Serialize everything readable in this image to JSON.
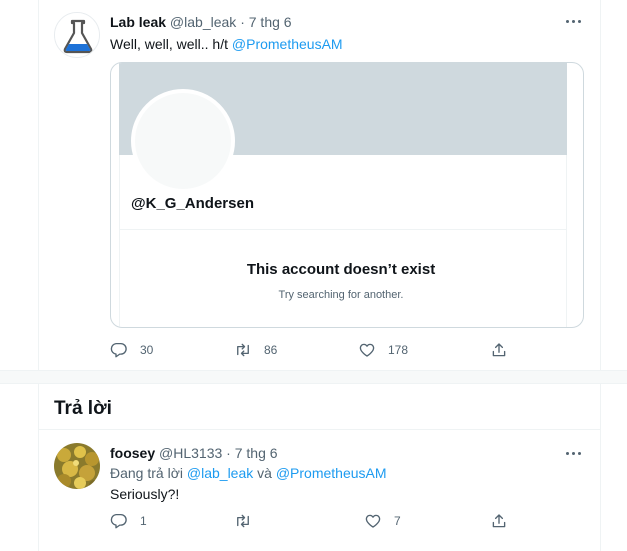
{
  "tweet": {
    "author_name": "Lab leak",
    "handle": "@lab_leak",
    "dot": "·",
    "date": "7 thg 6",
    "text": "Well, well, well.. h/t",
    "mention": "@PrometheusAM",
    "card": {
      "handle": "@K_G_Andersen",
      "title": "This account doesn’t exist",
      "subtitle": "Try searching for another."
    },
    "stats": {
      "replies": "30",
      "retweets": "86",
      "likes": "178"
    }
  },
  "replies_section": {
    "title": "Trả lời"
  },
  "reply": {
    "author_name": "foosey",
    "handle": "@HL3133",
    "dot": "·",
    "date": "7 thg 6",
    "replying_prefix": "Đang trả lời",
    "replying_to_1": "@lab_leak",
    "replying_and": "và",
    "replying_to_2": "@PrometheusAM",
    "text": "Seriously?!",
    "stats": {
      "replies": "1",
      "retweets": "",
      "likes": "7"
    }
  },
  "colors": {
    "accent": "#1d9bf0",
    "secondary_text": "#536471",
    "border": "#cfd9de"
  },
  "icons": {
    "author_avatar": "flask-icon",
    "reply": "reply-icon",
    "retweet": "retweet-icon",
    "like": "heart-icon",
    "share": "share-icon",
    "more": "more-icon"
  }
}
